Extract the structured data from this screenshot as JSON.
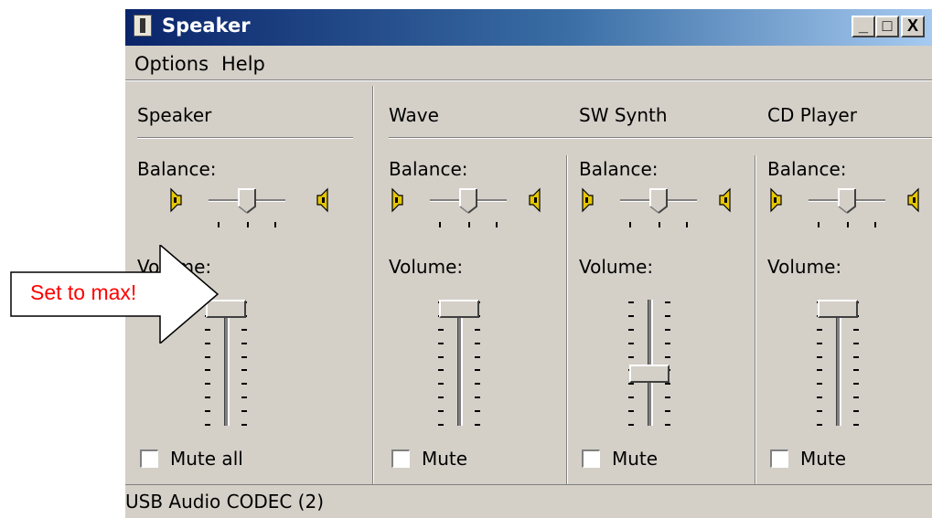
{
  "window": {
    "title": "Speaker",
    "controls": {
      "minimize": "_",
      "maximize": "□",
      "close": "X"
    }
  },
  "menu": [
    "Options",
    "Help"
  ],
  "master": {
    "name": "Speaker",
    "balance_label": "Balance:",
    "volume_label": "Volume:",
    "volume_level": 1.0,
    "mute_label": "Mute all",
    "mute_checked": false
  },
  "channels": [
    {
      "name": "Wave",
      "balance_label": "Balance:",
      "volume_label": "Volume:",
      "volume_level": 1.0,
      "mute_label": "Mute",
      "mute_checked": false
    },
    {
      "name": "SW Synth",
      "balance_label": "Balance:",
      "volume_label": "Volume:",
      "volume_level": 0.4,
      "mute_label": "Mute",
      "mute_checked": false
    },
    {
      "name": "CD Player",
      "balance_label": "Balance:",
      "volume_label": "Volume:",
      "volume_level": 1.0,
      "mute_label": "Mute",
      "mute_checked": false
    }
  ],
  "status": "USB Audio CODEC  (2)",
  "annotation": {
    "text": "Set to max!",
    "color": "#ff0000"
  },
  "colors": {
    "face": "#d4d0c8",
    "titlebar_start": "#0a246a",
    "titlebar_end": "#a6caf0",
    "speaker_icon": "#e6c700"
  }
}
